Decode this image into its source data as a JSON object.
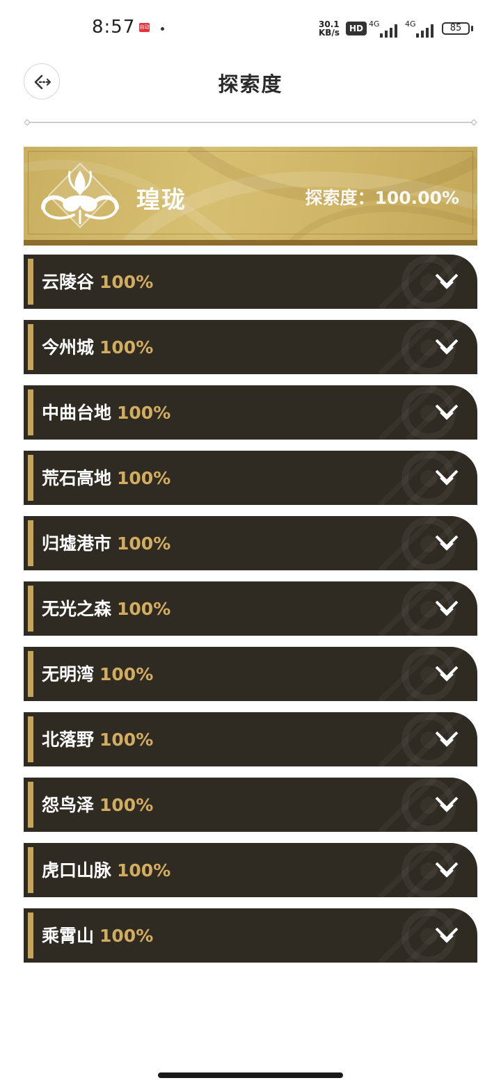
{
  "status_bar": {
    "time": "8:57",
    "notif_text": "自动",
    "net_speed_value": "30.1",
    "net_speed_unit": "KB/s",
    "hd_label": "HD",
    "signal_1": "4G",
    "signal_2": "4G",
    "battery": "85"
  },
  "header": {
    "title": "探索度"
  },
  "region": {
    "name": "瑝珑",
    "progress_label": "探索度：100.00%"
  },
  "areas": [
    {
      "name": "云陵谷",
      "percent": "100%"
    },
    {
      "name": "今州城",
      "percent": "100%"
    },
    {
      "name": "中曲台地",
      "percent": "100%"
    },
    {
      "name": "荒石高地",
      "percent": "100%"
    },
    {
      "name": "归墟港市",
      "percent": "100%"
    },
    {
      "name": "无光之森",
      "percent": "100%"
    },
    {
      "name": "无明湾",
      "percent": "100%"
    },
    {
      "name": "北落野",
      "percent": "100%"
    },
    {
      "name": "怨鸟泽",
      "percent": "100%"
    },
    {
      "name": "虎口山脉",
      "percent": "100%"
    },
    {
      "name": "乘霄山",
      "percent": "100%"
    }
  ],
  "colors": {
    "row_bg": "#302b22",
    "gold_accent": "#c5a557",
    "percent_text": "#d2ad60",
    "banner_gold": "#d7bf72"
  },
  "icons": {
    "back": "back-arrow-icon",
    "expand": "chevron-down-icon",
    "region_emblem": "dragon-emblem-icon"
  }
}
